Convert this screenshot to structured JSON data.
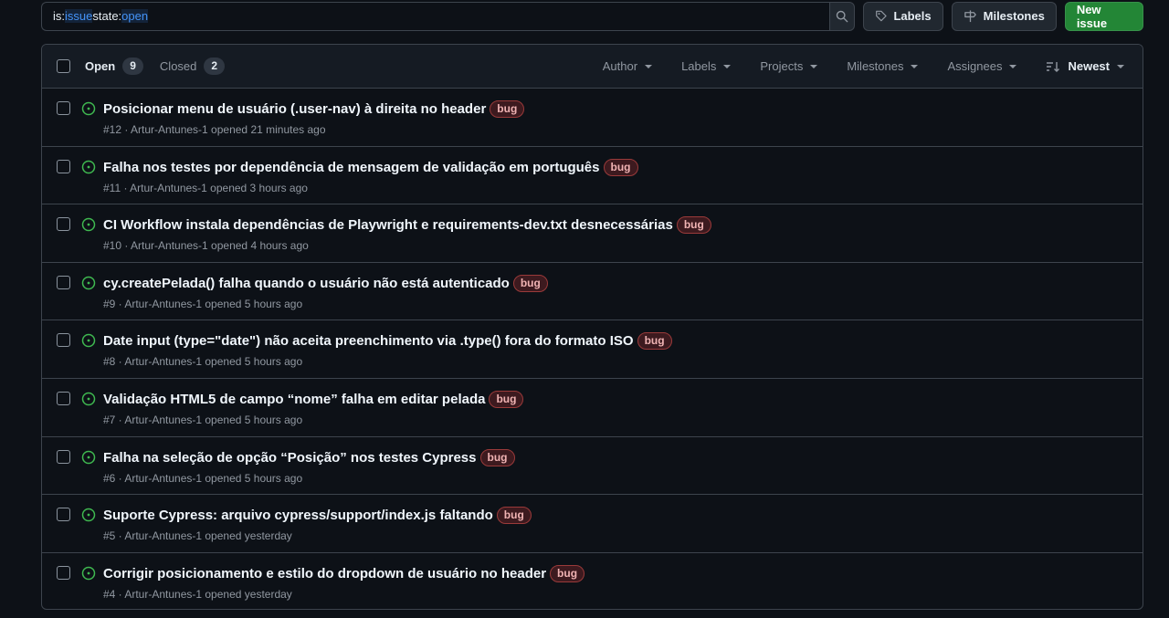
{
  "search": {
    "tokens": [
      {
        "key": "is:",
        "value": "issue"
      },
      {
        "key": " state:",
        "value": "open"
      }
    ]
  },
  "toolbar": {
    "labels_label": "Labels",
    "milestones_label": "Milestones",
    "new_issue_label": "New issue"
  },
  "list_header": {
    "open_label": "Open",
    "open_count": "9",
    "closed_label": "Closed",
    "closed_count": "2",
    "filters": [
      "Author",
      "Labels",
      "Projects",
      "Milestones",
      "Assignees"
    ],
    "sort_label": "Newest"
  },
  "issues": [
    {
      "title": "Posicionar menu de usuário (.user-nav) à direita no header",
      "label": "bug",
      "meta": "#12 · Artur-Antunes-1 opened 21 minutes ago"
    },
    {
      "title": "Falha nos testes por dependência de mensagem de validação em português",
      "label": "bug",
      "meta": "#11 · Artur-Antunes-1 opened 3 hours ago"
    },
    {
      "title": "CI Workflow instala dependências de Playwright e requirements-dev.txt desnecessárias",
      "label": "bug",
      "meta": "#10 · Artur-Antunes-1 opened 4 hours ago"
    },
    {
      "title": "cy.createPelada() falha quando o usuário não está autenticado",
      "label": "bug",
      "meta": "#9 · Artur-Antunes-1 opened 5 hours ago"
    },
    {
      "title": "Date input (type=\"date\") não aceita preenchimento via .type() fora do formato ISO",
      "label": "bug",
      "meta": "#8 · Artur-Antunes-1 opened 5 hours ago"
    },
    {
      "title": "Validação HTML5 de campo “nome” falha em editar pelada",
      "label": "bug",
      "meta": "#7 · Artur-Antunes-1 opened 5 hours ago"
    },
    {
      "title": "Falha na seleção de opção “Posição” nos testes Cypress",
      "label": "bug",
      "meta": "#6 · Artur-Antunes-1 opened 5 hours ago"
    },
    {
      "title": "Suporte Cypress: arquivo cypress/support/index.js faltando",
      "label": "bug",
      "meta": "#5 · Artur-Antunes-1 opened yesterday"
    },
    {
      "title": "Corrigir posicionamento e estilo do dropdown de usuário no header",
      "label": "bug",
      "meta": "#4 · Artur-Antunes-1 opened yesterday"
    }
  ],
  "colors": {
    "background": "#0d1117",
    "border": "#3d444d",
    "open_icon": "#3fb950",
    "primary_button": "#238636",
    "bug_label_text": "#f0b3b3",
    "bug_label_border": "#9a3a3a",
    "search_token_value": "#4493f8"
  },
  "icons": {
    "search": "search-icon",
    "labels": "tag-icon",
    "milestones": "milestone-icon",
    "sort": "sort-desc-icon",
    "issue_open": "issue-opened-icon"
  }
}
